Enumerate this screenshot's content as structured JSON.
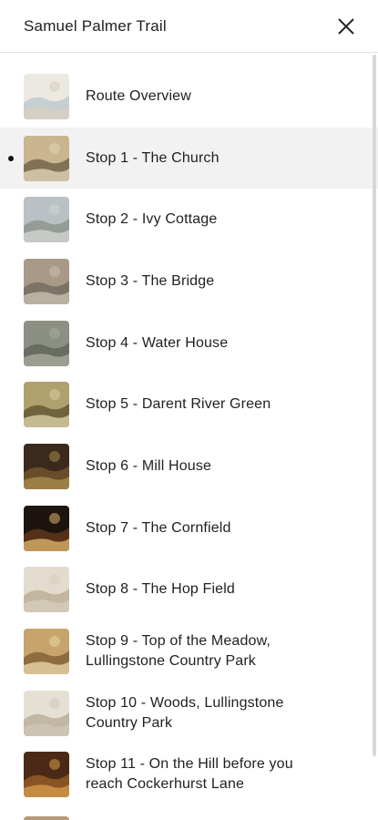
{
  "header": {
    "title": "Samuel Palmer Trail"
  },
  "items": [
    {
      "label": "Route Overview",
      "thumb": "map-thumbnail",
      "colors": [
        "#ece9e2",
        "#b8c4c9",
        "#d9cfc0"
      ]
    },
    {
      "label": "Stop 1 - The Church",
      "thumb": "portrait-thumbnail",
      "colors": [
        "#c9b68f",
        "#6b5a42",
        "#e0d3b6"
      ],
      "active": true
    },
    {
      "label": "Stop 2 - Ivy Cottage",
      "thumb": "landscape-thumbnail",
      "colors": [
        "#b9c1c4",
        "#8a8f85",
        "#d2d6d2"
      ]
    },
    {
      "label": "Stop 3 - The Bridge",
      "thumb": "landscape-thumbnail",
      "colors": [
        "#a89a86",
        "#6f675c",
        "#c9bfb0"
      ]
    },
    {
      "label": "Stop 4 - Water House",
      "thumb": "sketch-thumbnail",
      "colors": [
        "#8c9084",
        "#5c6157",
        "#a8aa9e"
      ]
    },
    {
      "label": "Stop 5 - Darent River Green",
      "thumb": "tree-thumbnail",
      "colors": [
        "#b0a06e",
        "#5b5030",
        "#d8cfa4"
      ]
    },
    {
      "label": "Stop 6 - Mill House",
      "thumb": "painting-thumbnail",
      "colors": [
        "#3b2a1b",
        "#7a5a30",
        "#a88b4e"
      ]
    },
    {
      "label": "Stop 7 - The Cornfield",
      "thumb": "night-thumbnail",
      "colors": [
        "#1d1410",
        "#6a3b1a",
        "#d9b36a"
      ]
    },
    {
      "label": "Stop 8 - The Hop Field",
      "thumb": "sketch-thumbnail",
      "colors": [
        "#e3dcce",
        "#b8a98f",
        "#d6cdbb"
      ]
    },
    {
      "label": "Stop 9 - Top of the Meadow, Lullingstone Country Park",
      "thumb": "landscape-thumbnail",
      "colors": [
        "#c6a46c",
        "#7a5a32",
        "#e8d6a8"
      ]
    },
    {
      "label": "Stop 10 - Woods, Lullingstone Country Park",
      "thumb": "sketch-thumbnail",
      "colors": [
        "#e6e0d4",
        "#b5aa96",
        "#cfc6b6"
      ]
    },
    {
      "label": "Stop 11 - On the Hill before you reach Cockerhurst Lane",
      "thumb": "painting-thumbnail",
      "colors": [
        "#4a2a16",
        "#a0622a",
        "#d59a4a"
      ]
    }
  ]
}
